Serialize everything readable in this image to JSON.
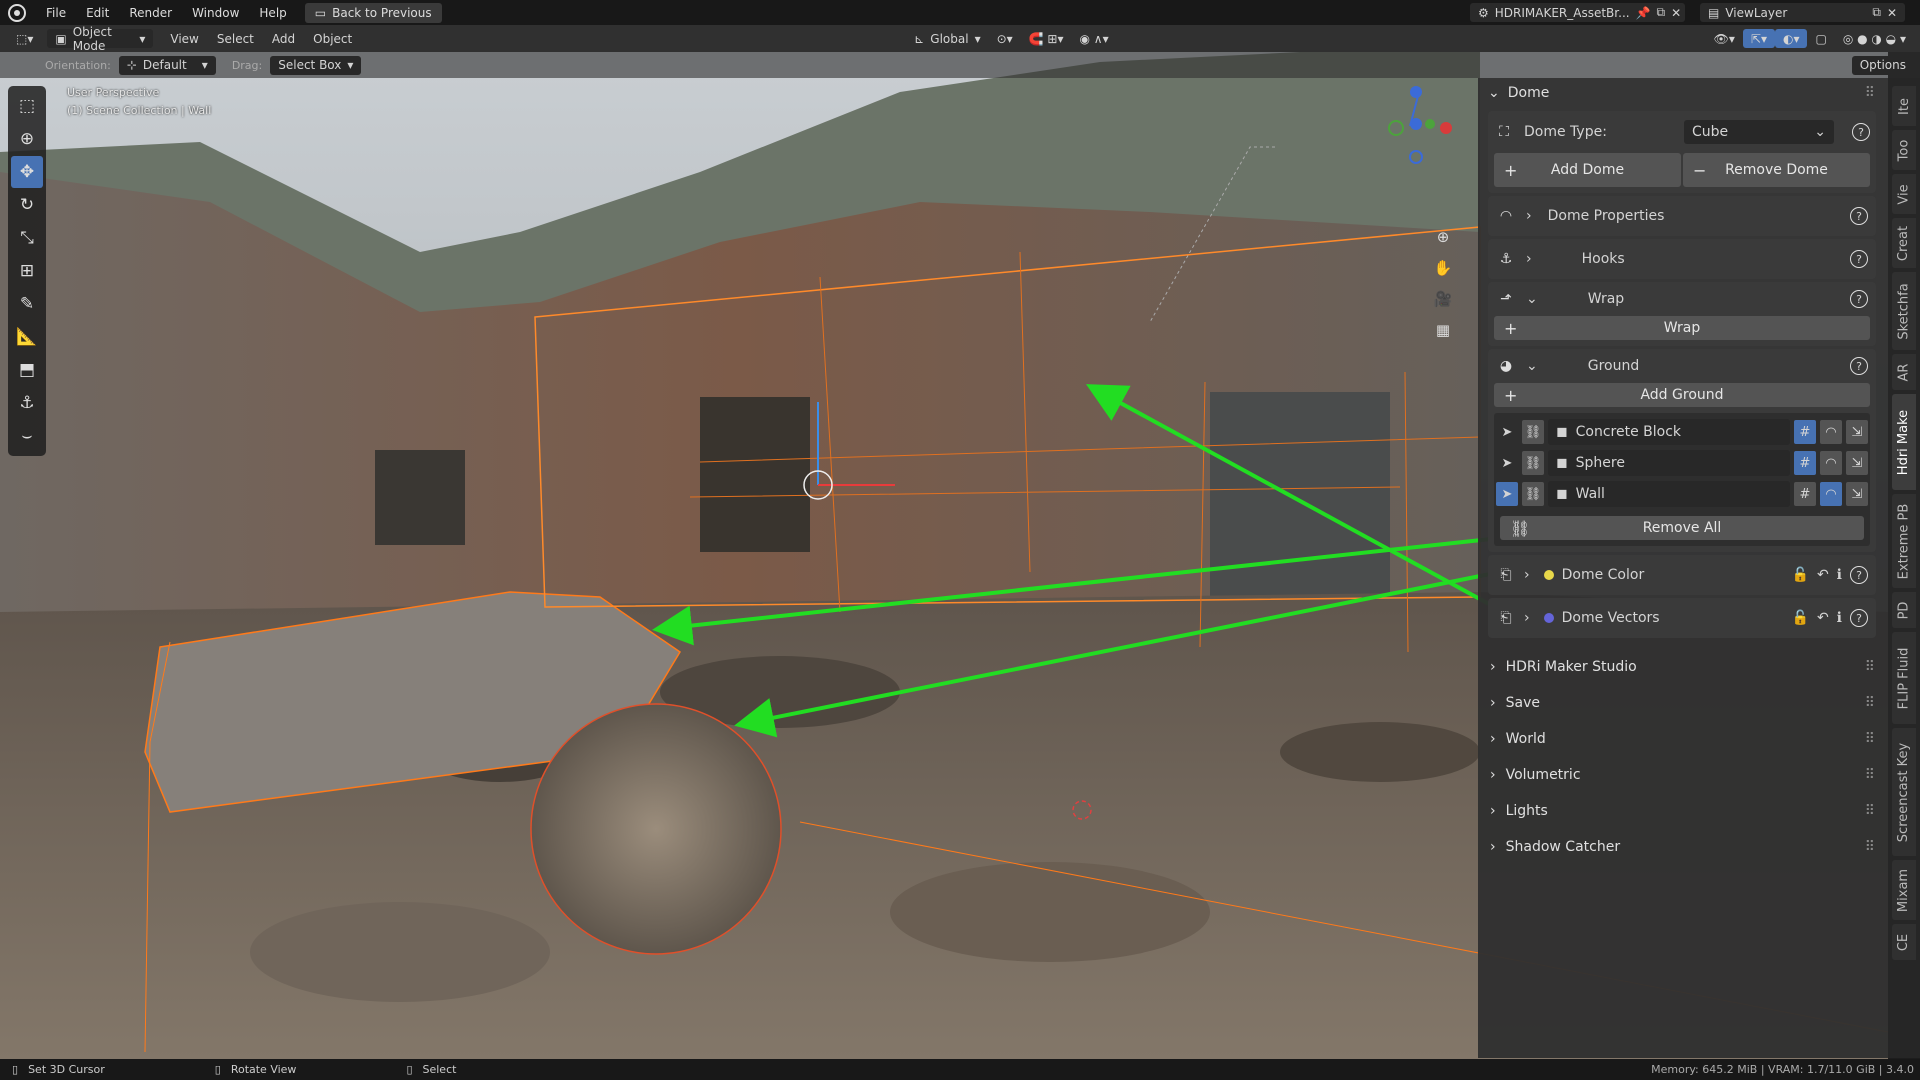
{
  "topbar": {
    "menus": [
      "File",
      "Edit",
      "Render",
      "Window",
      "Help"
    ],
    "back_button": "Back to Previous",
    "scene": "HDRIMAKER_AssetBr...",
    "view_layer": "ViewLayer"
  },
  "header": {
    "mode": "Object Mode",
    "menus": [
      "View",
      "Select",
      "Add",
      "Object"
    ],
    "transform_orientation": "Global",
    "orientation_label": "Orientation:",
    "orientation_value": "Default",
    "drag_label": "Drag:",
    "drag_value": "Select Box",
    "options": "Options"
  },
  "viewport": {
    "perspective": "User Perspective",
    "collection": "(1) Scene Collection | Wall"
  },
  "panel": {
    "title": "Dome",
    "dome_type_label": "Dome Type:",
    "dome_type_value": "Cube",
    "add_dome": "Add Dome",
    "remove_dome": "Remove Dome",
    "dome_properties": "Dome Properties",
    "hooks": "Hooks",
    "wrap_header": "Wrap",
    "wrap_button": "Wrap",
    "ground_header": "Ground",
    "add_ground": "Add Ground",
    "objects": [
      {
        "name": "Concrete Block"
      },
      {
        "name": "Sphere"
      },
      {
        "name": "Wall"
      }
    ],
    "remove_all": "Remove All",
    "dome_color": "Dome Color",
    "dome_color_dot": "#e8d84a",
    "dome_vectors": "Dome Vectors",
    "dome_vectors_dot": "#6464d8",
    "sections": [
      "HDRi Maker Studio",
      "Save",
      "World",
      "Volumetric",
      "Lights",
      "Shadow Catcher"
    ]
  },
  "right_tabs": [
    "Ite",
    "Too",
    "Vie",
    "Creat",
    "Sketchfa",
    "AR",
    "Hdri Make",
    "Extreme PB",
    "PD",
    "FLIP Fluid",
    "Screencast Key",
    "Mixam",
    "CE"
  ],
  "statusbar": {
    "left1": "Set 3D Cursor",
    "left2": "Rotate View",
    "left3": "Select",
    "right": "Memory: 645.2 MiB | VRAM: 1.7/11.0 GiB | 3.4.0"
  },
  "colors": {
    "accent": "#4772b3",
    "arrow": "#22dd22",
    "selection": "#ff7a1a"
  }
}
